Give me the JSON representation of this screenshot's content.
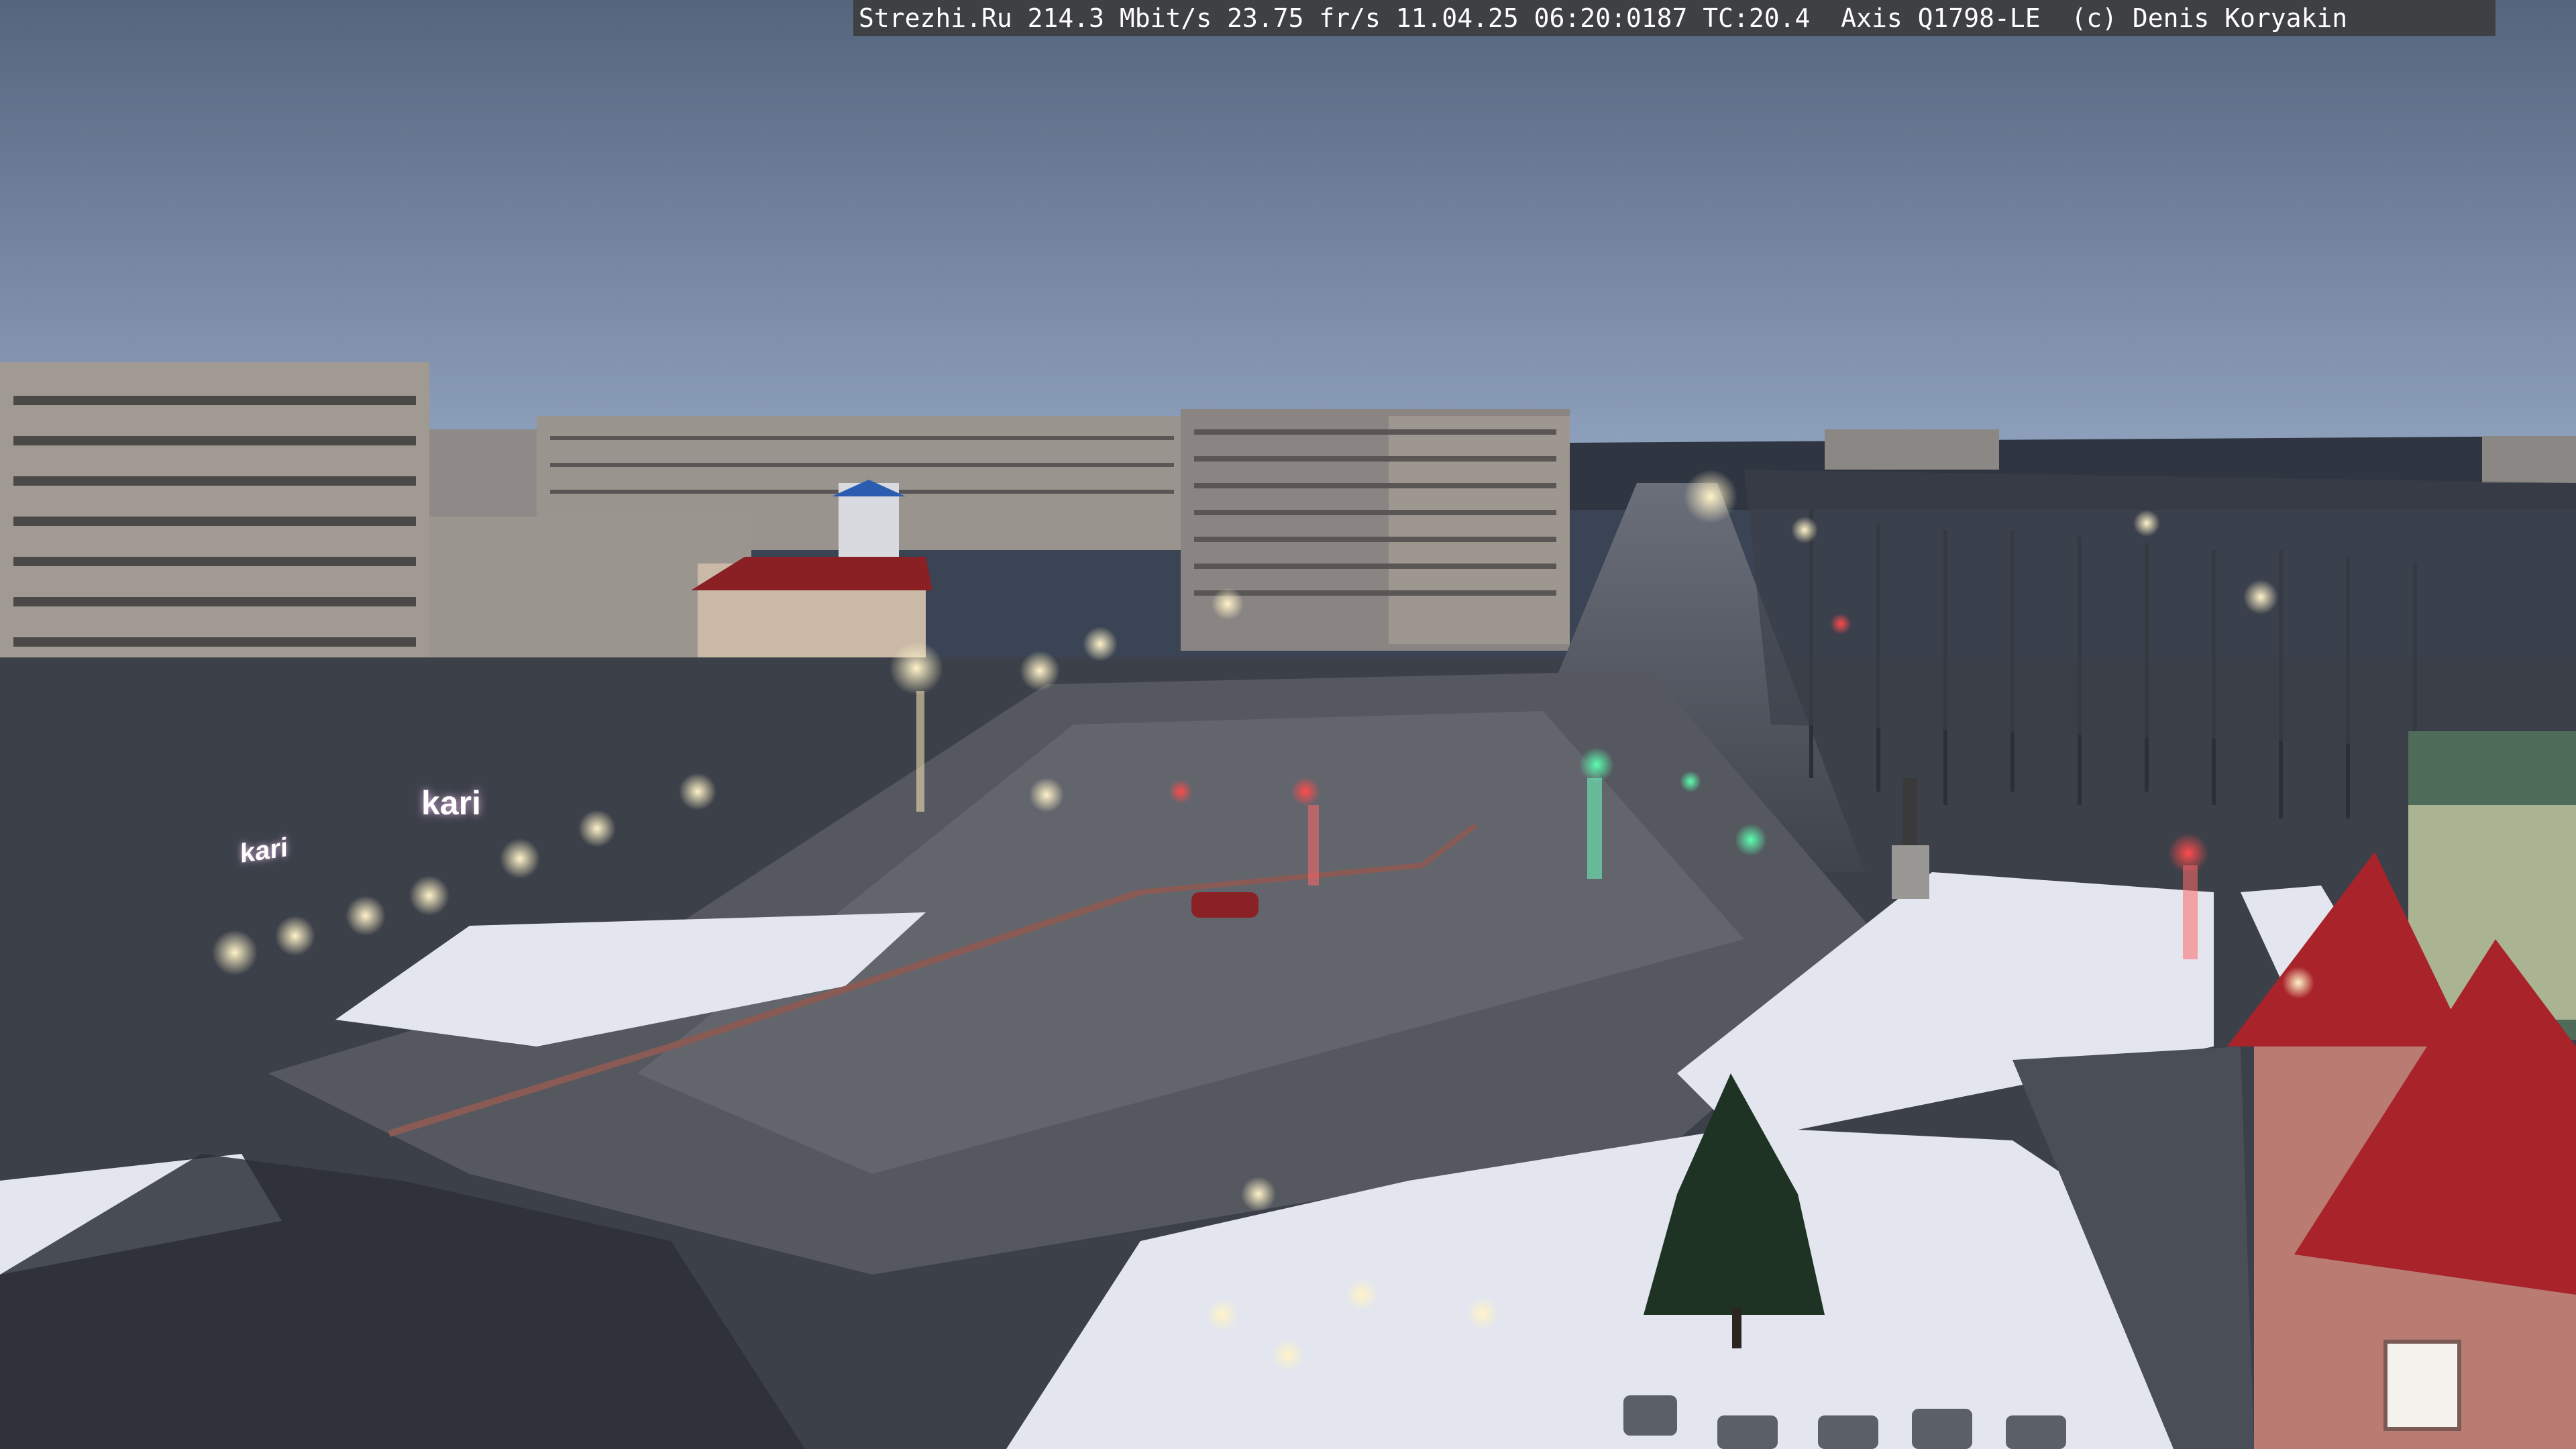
{
  "overlay": {
    "text": "Strezhi.Ru 214.3 Mbit/s 23.75 fr/s 11.04.25 06:20:0187 TC:20.4  Axis Q1798-LE  (c) Denis Koryakin"
  },
  "signs": {
    "kari_main": "kari",
    "kari_side": "kari"
  },
  "colors": {
    "sky_top": "#5a6b85",
    "sky_horizon": "#8da0bd",
    "asphalt": "#4a4d55",
    "snow": "#e6e9f0",
    "brick": "#8a3a2e",
    "roof_red": "#a8232a",
    "lamp": "#ffe7b0",
    "traffic_green": "#3cff9a",
    "traffic_red": "#ff3b3b",
    "sign_magenta": "#8a2a6a"
  }
}
